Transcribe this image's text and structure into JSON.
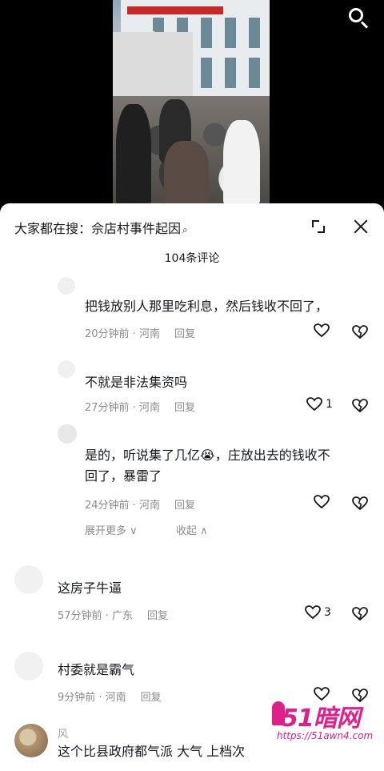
{
  "video": {
    "search_icon": "search-icon"
  },
  "sheet": {
    "search_prefix": "大家都在搜：",
    "search_keyword": "佘店村事件起因",
    "search_icon": "magnifier-icon",
    "comment_count": "104条评论"
  },
  "comments": [
    {
      "text": "把钱放别人那里吃利息，然后钱收不回了，",
      "time": "20分钟前 · 河南",
      "reply": "回复",
      "likes": ""
    },
    {
      "text": "不就是非法集资吗",
      "time": "27分钟前 · 河南",
      "reply": "回复",
      "likes": "1"
    },
    {
      "text_line1": "是的，听说集了几亿",
      "emoji": "😭",
      "text_line1_rest": "，庄放出去的钱收不",
      "text_line2": "回了，暴雷了",
      "time": "24分钟前 · 河南",
      "reply": "回复",
      "likes": "",
      "expand_more": "展开更多 ∨",
      "collapse": "收起 ∧"
    },
    {
      "text": "这房子牛逼",
      "time": "57分钟前 · 广东",
      "reply": "回复",
      "likes": "3"
    },
    {
      "text": "村委就是霸气",
      "time": "9分钟前 · 河南",
      "reply": "回复",
      "likes": ""
    },
    {
      "username": "风",
      "text": "这个比县政府都气派  大气  上档次"
    }
  ],
  "watermark": {
    "logo": "51暗网",
    "url": "https://51awn4.com"
  },
  "colors": {
    "watermark": "#e0208a",
    "meta": "#8a8b91",
    "text": "#161823"
  }
}
